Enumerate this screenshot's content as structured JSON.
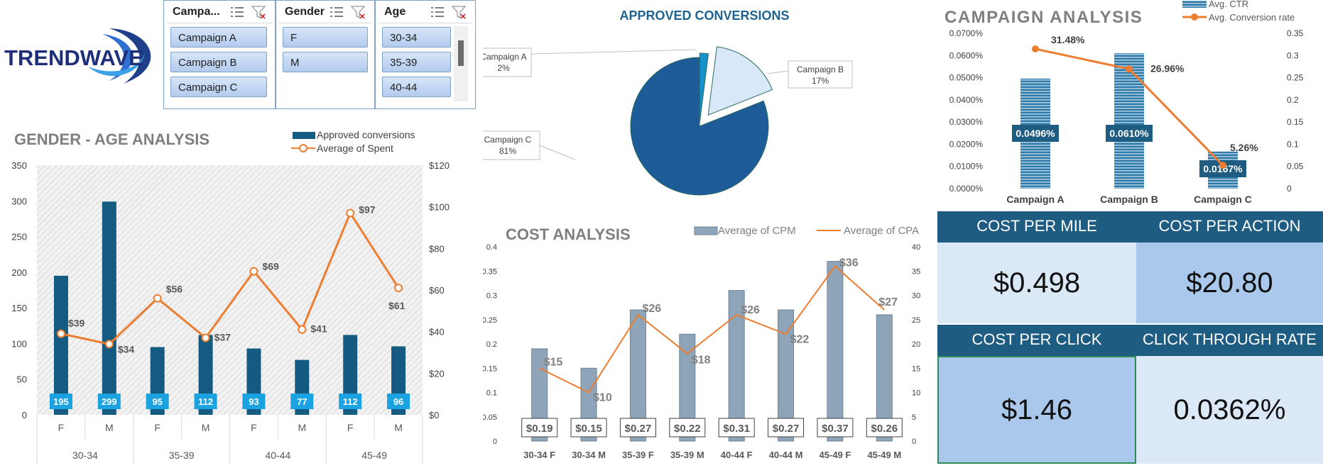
{
  "brand": {
    "name": "TRENDWAVE"
  },
  "slicers": [
    {
      "title": "Campa...",
      "items": [
        "Campaign A",
        "Campaign B",
        "Campaign C"
      ]
    },
    {
      "title": "Gender",
      "items": [
        "F",
        "M"
      ]
    },
    {
      "title": "Age",
      "items": [
        "30-34",
        "35-39",
        "40-44"
      ]
    }
  ],
  "kpis": {
    "cpm_label": "COST PER MILE",
    "cpm_value": "$0.498",
    "cpa_label": "COST PER ACTION",
    "cpa_value": "$20.80",
    "cpc_label": "COST PER CLICK",
    "cpc_value": "$1.46",
    "ctr_label": "CLICK THROUGH RATE",
    "ctr_value": "0.0362%"
  },
  "colors": {
    "navy": "#155a80",
    "orange": "#ed7d31",
    "kpi_head": "#1f5c82",
    "kpi_light": "#dbe8f6",
    "kpi_mid": "#a9c8ec",
    "slate": "#8ea4b8"
  },
  "chart_data": [
    {
      "type": "bar",
      "title": "GENDER - AGE ANALYSIS",
      "categories": [
        "F",
        "M",
        "F",
        "M",
        "F",
        "M",
        "F",
        "M"
      ],
      "groups": [
        "30-34",
        "35-39",
        "40-44",
        "45-49"
      ],
      "series": [
        {
          "name": "Approved conversions",
          "values": [
            195,
            299,
            95,
            112,
            93,
            77,
            112,
            96
          ],
          "axis": "left"
        },
        {
          "name": "Average of Spent",
          "values": [
            39,
            34,
            56,
            37,
            69,
            41,
            97,
            61
          ],
          "axis": "right"
        }
      ],
      "ylim": [
        0,
        350
      ],
      "y2lim": [
        0,
        120
      ],
      "yticks": [
        "0",
        "50",
        "100",
        "150",
        "200",
        "250",
        "300",
        "350"
      ],
      "y2ticks": [
        "$0",
        "$20",
        "$40",
        "$60",
        "$80",
        "$100",
        "$120"
      ],
      "data_labels": [
        "195",
        "299",
        "95",
        "112",
        "93",
        "77",
        "112",
        "96"
      ],
      "line_labels": [
        "$39",
        "$34",
        "$56",
        "$37",
        "$69",
        "$41",
        "$97",
        "$61"
      ],
      "legend": "top-right"
    },
    {
      "type": "pie",
      "title": "APPROVED CONVERSIONS",
      "categories": [
        "Campaign A",
        "Campaign B",
        "Campaign C"
      ],
      "values": [
        2,
        17,
        81
      ],
      "labels": [
        "2%",
        "17%",
        "81%"
      ]
    },
    {
      "type": "bar",
      "title": "CAMPAIGN ANALYSIS",
      "categories": [
        "Campaign A",
        "Campaign B",
        "Campaign C"
      ],
      "series": [
        {
          "name": "Avg. CTR",
          "values": [
            0.0496,
            0.061,
            0.0167
          ],
          "axis": "left"
        },
        {
          "name": "Avg. Conversion rate",
          "values": [
            0.3148,
            0.2696,
            0.0526
          ],
          "axis": "right"
        }
      ],
      "ylim": [
        0,
        0.07
      ],
      "y2lim": [
        0,
        0.35
      ],
      "yticks": [
        "0.0000%",
        "0.0100%",
        "0.0200%",
        "0.0300%",
        "0.0400%",
        "0.0500%",
        "0.0600%",
        "0.0700%"
      ],
      "y2ticks": [
        "0",
        "0.05",
        "0.1",
        "0.15",
        "0.2",
        "0.25",
        "0.3",
        "0.35"
      ],
      "bar_labels": [
        "0.0496%",
        "0.0610%",
        "0.0167%"
      ],
      "line_labels": [
        "31.48%",
        "26.96%",
        "5.26%"
      ],
      "legend": "top-right"
    },
    {
      "type": "bar",
      "title": "COST ANALYSIS",
      "categories": [
        "30-34 F",
        "30-34 M",
        "35-39 F",
        "35-39 M",
        "40-44 F",
        "40-44 M",
        "45-49 F",
        "45-49 M"
      ],
      "series": [
        {
          "name": "Average of CPM",
          "values": [
            0.19,
            0.15,
            0.27,
            0.22,
            0.31,
            0.27,
            0.37,
            0.26
          ],
          "axis": "left"
        },
        {
          "name": "Average of CPA",
          "values": [
            15,
            10,
            26,
            18,
            26,
            22,
            36,
            27
          ],
          "axis": "right"
        }
      ],
      "ylim": [
        0,
        0.4
      ],
      "y2lim": [
        0,
        40
      ],
      "yticks": [
        "0",
        "0.05",
        "0.1",
        "0.15",
        "0.2",
        "0.25",
        "0.3",
        "0.35",
        "0.4"
      ],
      "y2ticks": [
        "0",
        "5",
        "10",
        "15",
        "20",
        "25",
        "30",
        "35",
        "40"
      ],
      "bar_labels": [
        "$0.19",
        "$0.15",
        "$0.27",
        "$0.22",
        "$0.31",
        "$0.27",
        "$0.37",
        "$0.26"
      ],
      "line_labels": [
        "$15",
        "$10",
        "$26",
        "$18",
        "$26",
        "$22",
        "$36",
        "$27"
      ],
      "legend": "top-right"
    }
  ]
}
